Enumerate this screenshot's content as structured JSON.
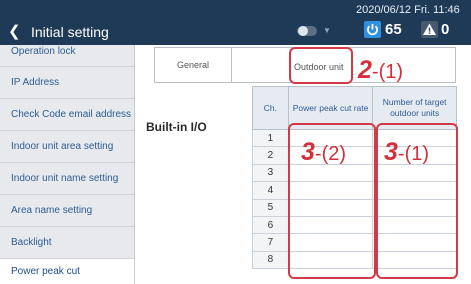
{
  "header": {
    "back_glyph": "❮",
    "title": "Initial setting",
    "datetime": "2020/06/12 Fri. 11:46",
    "dropdown_glyph": "▼",
    "power_count": "65",
    "warning_count": "0",
    "icons": [
      "back-arrow-icon",
      "toggle-icon",
      "chevron-down-icon",
      "power-icon",
      "warning-icon"
    ]
  },
  "sidebar": {
    "items": [
      {
        "label": "Operation lock"
      },
      {
        "label": "IP Address"
      },
      {
        "label": "Check Code email address"
      },
      {
        "label": "Indoor unit area setting"
      },
      {
        "label": "Indoor unit name setting"
      },
      {
        "label": "Area name setting"
      },
      {
        "label": "Backlight"
      },
      {
        "label": "Power peak cut",
        "active": true
      }
    ]
  },
  "tabs": {
    "general": "General",
    "outdoor": "Outdoor unit"
  },
  "section": {
    "label": "Built-in I/O"
  },
  "table": {
    "headers": [
      "Ch.",
      "Power peak cut rate",
      "Number of target outdoor units"
    ],
    "rows": [
      "1",
      "2",
      "3",
      "4",
      "5",
      "6",
      "7",
      "8"
    ]
  },
  "annotations": {
    "a1_num": "2",
    "a1_suffix": "-(1)",
    "a2_num": "3",
    "a2_suffix": "-(2)",
    "a3_num": "3",
    "a3_suffix": "-(1)",
    "color": "#d42f3b"
  },
  "colors": {
    "header_bg": "#1f3a57",
    "sidebar_bg": "#e7e9ec",
    "accent_blue": "#2f8fe0",
    "link_text": "#2c5d93"
  }
}
